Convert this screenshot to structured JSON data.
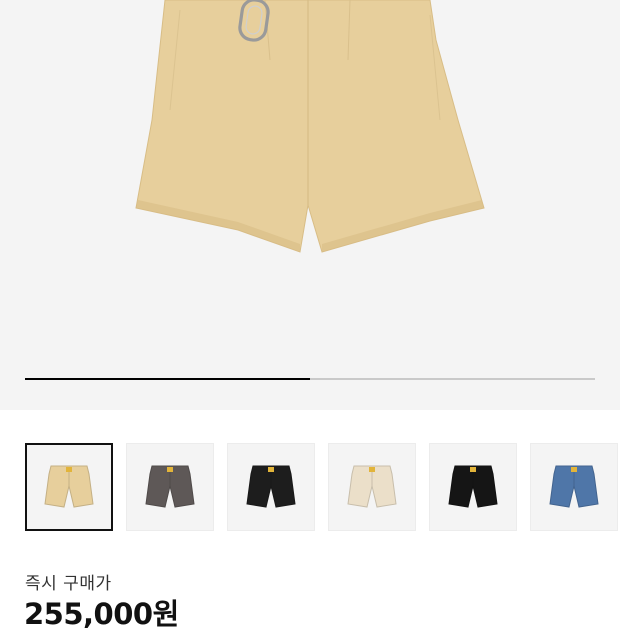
{
  "product": {
    "main_image": {
      "icon": "beige-shorts-with-carabiner",
      "color": "#e7cf9c",
      "carousel_progress": 0.5
    },
    "thumbnails": [
      {
        "icon": "beige-shorts",
        "color": "#e7cf9c",
        "selected": true
      },
      {
        "icon": "charcoal-shorts",
        "color": "#5e5857",
        "selected": false
      },
      {
        "icon": "black-shorts",
        "color": "#1d1d1d",
        "selected": false
      },
      {
        "icon": "cream-shorts",
        "color": "#ebdfc9",
        "selected": false
      },
      {
        "icon": "black-shorts",
        "color": "#151515",
        "selected": false
      },
      {
        "icon": "denim-blue-shorts",
        "color": "#4f76a8",
        "selected": false
      }
    ]
  },
  "pricing": {
    "label": "즉시 구매가",
    "value": "255,000원"
  },
  "colors": {
    "background": "#f4f4f4",
    "progress_active": "#000000",
    "progress_track": "#c9c9c9"
  }
}
